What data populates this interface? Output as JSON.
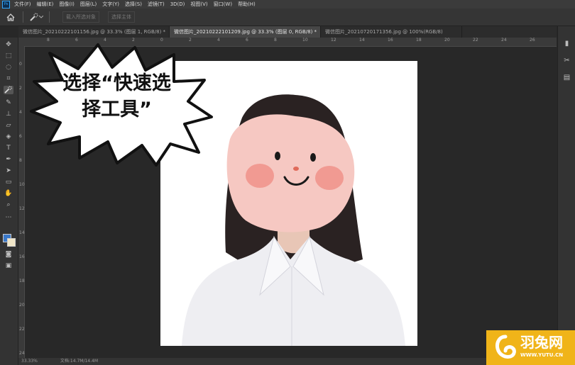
{
  "menubar": {
    "app_icon": "Ps",
    "items": [
      "文件(F)",
      "编辑(E)",
      "图像(I)",
      "图层(L)",
      "文字(Y)",
      "选择(S)",
      "滤镜(T)",
      "3D(D)",
      "视图(V)",
      "窗口(W)",
      "帮助(H)"
    ]
  },
  "options": {
    "home_icon": "home-icon",
    "tool_icon": "quick-selection-icon",
    "opt1": "载入所选对象",
    "opt2": "选择主体"
  },
  "tabs": [
    {
      "label": "微信图片_20210222101156.jpg @ 33.3% (图层 1, RGB/8) *"
    },
    {
      "label": "微信图片_20210222101209.jpg @ 33.3% (图层 0, RGB/8) *"
    },
    {
      "label": "微信图片_20210720171356.jpg @ 100%(RGB/8)"
    }
  ],
  "ruler": {
    "top": [
      "8",
      "6",
      "4",
      "2",
      "0",
      "2",
      "4",
      "6",
      "8",
      "10",
      "12",
      "14",
      "16",
      "18",
      "20",
      "22",
      "24",
      "26"
    ],
    "left": [
      "0",
      "2",
      "4",
      "6",
      "8",
      "10",
      "12",
      "14",
      "16",
      "18",
      "20",
      "22",
      "24"
    ]
  },
  "callout": {
    "line1": "选择“快速选",
    "line2": "择工具”"
  },
  "status": {
    "zoom": "33.33%",
    "doc": "文档:14.7M/14.4M"
  },
  "logo": {
    "name": "羽兔网",
    "url": "WWW.YUTU.CN"
  },
  "colors": {
    "foreground": "#3a78c8",
    "background": "#f0e6c8",
    "logo_bg": "#f0b419"
  }
}
